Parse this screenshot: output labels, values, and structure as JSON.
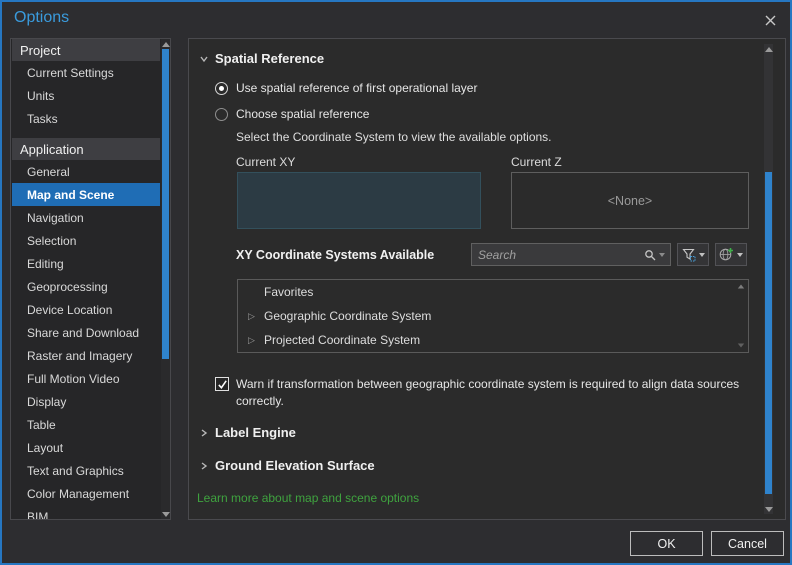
{
  "window": {
    "title": "Options"
  },
  "sidebar": {
    "sections": [
      {
        "header": "Project",
        "items": [
          {
            "label": "Current Settings"
          },
          {
            "label": "Units"
          },
          {
            "label": "Tasks"
          }
        ]
      },
      {
        "header": "Application",
        "items": [
          {
            "label": "General"
          },
          {
            "label": "Map and Scene",
            "selected": true
          },
          {
            "label": "Navigation"
          },
          {
            "label": "Selection"
          },
          {
            "label": "Editing"
          },
          {
            "label": "Geoprocessing"
          },
          {
            "label": "Device Location"
          },
          {
            "label": "Share and Download"
          },
          {
            "label": "Raster and Imagery"
          },
          {
            "label": "Full Motion Video"
          },
          {
            "label": "Display"
          },
          {
            "label": "Table"
          },
          {
            "label": "Layout"
          },
          {
            "label": "Text and Graphics"
          },
          {
            "label": "Color Management"
          },
          {
            "label": "BIM"
          }
        ]
      }
    ]
  },
  "main": {
    "spatial": {
      "title": "Spatial Reference",
      "radio_use_first": "Use spatial reference of first operational layer",
      "radio_choose": "Choose spatial reference",
      "select_hint": "Select the Coordinate System to view the available options.",
      "current_xy_label": "Current XY",
      "current_z_label": "Current Z",
      "current_z_value": "<None>",
      "xy_available_label": "XY Coordinate Systems Available",
      "search_placeholder": "Search",
      "tree": [
        {
          "label": "Favorites",
          "expandable": false
        },
        {
          "label": "Geographic Coordinate System",
          "expandable": true
        },
        {
          "label": "Projected Coordinate System",
          "expandable": true
        }
      ],
      "warn_text": "Warn if transformation between geographic coordinate system is required to align data sources correctly."
    },
    "label_engine_title": "Label Engine",
    "ground_elevation_title": "Ground Elevation Surface",
    "learn_more": "Learn more about map and scene options"
  },
  "footer": {
    "ok_label": "OK",
    "cancel_label": "Cancel"
  },
  "colors": {
    "accent_scrollbar": "#2f83cc",
    "selection_blue": "#1f6db5",
    "dialog_border_blue": "#2677c2",
    "title_blue": "#3a9bdd",
    "link_green": "#3fa33f",
    "current_xy_highlight": "#2c3b44"
  }
}
